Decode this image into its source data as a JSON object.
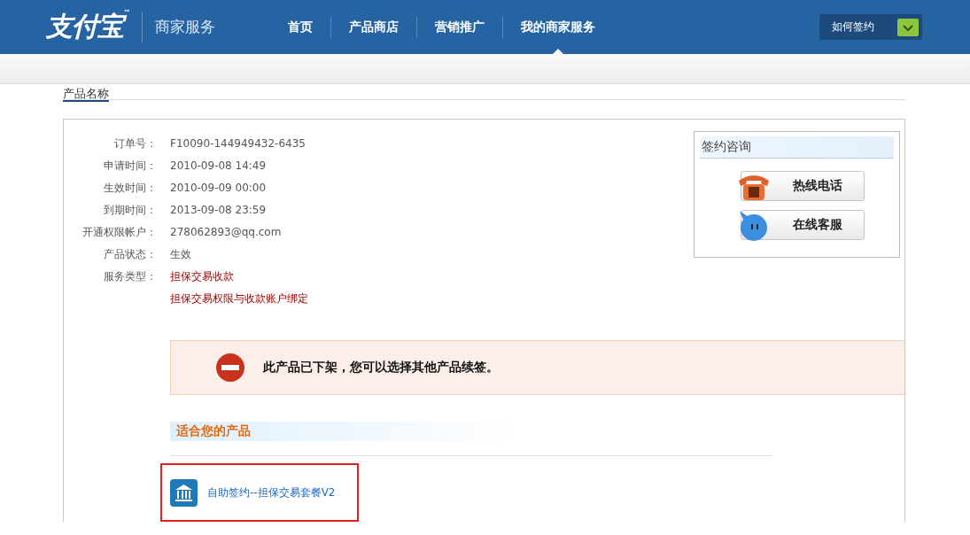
{
  "header": {
    "logo": "支付宝",
    "logo_mark": "™",
    "section": "商家服务",
    "nav": [
      {
        "label": "首页",
        "selected": false
      },
      {
        "label": "产品商店",
        "selected": false
      },
      {
        "label": "营销推广",
        "selected": false
      },
      {
        "label": "我的商家服务",
        "selected": true
      }
    ],
    "help_dropdown": "如何签约"
  },
  "page_tab": "产品名称",
  "details": [
    {
      "label": "订单号：",
      "values": [
        "F10090-144949432-6435"
      ],
      "emphasized": false
    },
    {
      "label": "申请时间：",
      "values": [
        "2010-09-08 14:49"
      ],
      "emphasized": false
    },
    {
      "label": "生效时间：",
      "values": [
        "2010-09-09 00:00"
      ],
      "emphasized": false
    },
    {
      "label": "到期时间：",
      "values": [
        "2013-09-08 23:59"
      ],
      "emphasized": false
    },
    {
      "label": "开通权限帐户：",
      "values": [
        "278062893@qq.com"
      ],
      "emphasized": false
    },
    {
      "label": "产品状态：",
      "values": [
        "生效"
      ],
      "emphasized": false
    },
    {
      "label": "服务类型：",
      "values": [
        "担保交易收款",
        "担保交易权限与收款账户绑定"
      ],
      "emphasized": true
    }
  ],
  "consult": {
    "title": "签约咨询",
    "buttons": [
      {
        "kind": "phone",
        "label": "热线电话"
      },
      {
        "kind": "chat",
        "label": "在线客服"
      }
    ]
  },
  "notice": "此产品已下架，您可以选择其他产品续签。",
  "suggested": {
    "title": "适合您的产品",
    "products": [
      {
        "label": "自助签约--担保交易套餐V2",
        "highlighted": true
      }
    ]
  }
}
